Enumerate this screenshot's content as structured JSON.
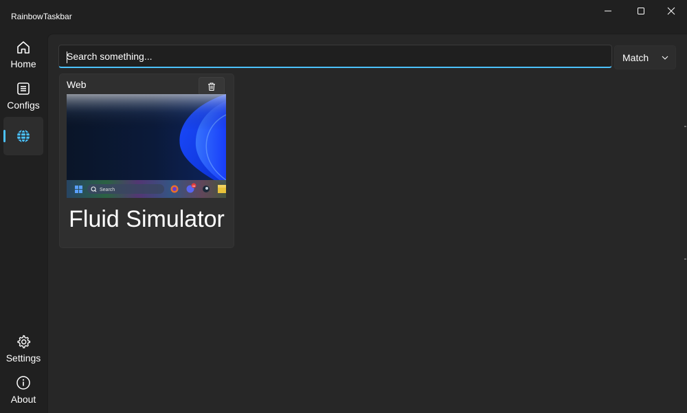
{
  "app": {
    "title": "RainbowTaskbar"
  },
  "sidebar": {
    "items": [
      {
        "label": "Home",
        "icon": "home-icon"
      },
      {
        "label": "Configs",
        "icon": "list-icon"
      },
      {
        "label": "",
        "icon": "globe-icon",
        "selected": true
      }
    ],
    "footer_items": [
      {
        "label": "Settings",
        "icon": "gear-icon"
      },
      {
        "label": "About",
        "icon": "info-icon"
      }
    ]
  },
  "search": {
    "placeholder": "Search something...",
    "value": ""
  },
  "match_select": {
    "selected": "Match"
  },
  "cards": [
    {
      "type": "Web",
      "title": "Fluid Simulator",
      "preview_search_text": "Search",
      "preview_badge": "44"
    }
  ],
  "colors": {
    "accent": "#4cc2ff",
    "background": "#202020",
    "content": "#272727",
    "card": "#2f2f2f"
  }
}
